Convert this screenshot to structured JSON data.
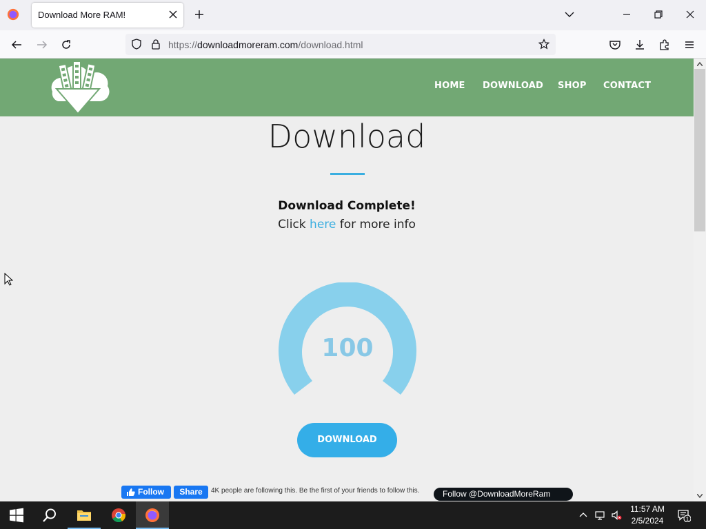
{
  "browser": {
    "tab_title": "Download More RAM!",
    "url_scheme": "https://",
    "url_host": "downloadmoreram.com",
    "url_path": "/download.html"
  },
  "site": {
    "nav": [
      "HOME",
      "DOWNLOAD",
      "SHOP",
      "CONTACT"
    ],
    "heading": "Download",
    "complete_text": "Download Complete!",
    "info_prefix": "Click",
    "info_link": "here",
    "info_suffix": "for more info",
    "gauge_value": "100",
    "download_button": "DOWNLOAD",
    "fb_follow": "Follow",
    "fb_share": "Share",
    "fb_text": "4K people are following this. Be the first of your friends to follow this.",
    "x_follow": "Follow @DownloadMoreRam"
  },
  "taskbar": {
    "time": "11:57 AM",
    "date": "2/5/2024",
    "notification_count": "1"
  },
  "colors": {
    "header_green": "#72a874",
    "accent_blue": "#34aee8",
    "gauge_blue": "#88c8e6"
  },
  "icons": [
    "firefox-icon",
    "close-icon",
    "plus-icon",
    "chevron-down-icon",
    "minimize-icon",
    "restore-icon",
    "back-icon",
    "forward-icon",
    "reload-icon",
    "shield-icon",
    "lock-icon",
    "star-icon",
    "pocket-icon",
    "download-icon",
    "extensions-icon",
    "menu-icon",
    "windows-start-icon",
    "search-icon",
    "file-explorer-icon",
    "chrome-icon",
    "chevron-up-icon",
    "network-icon",
    "volume-muted-icon",
    "notification-icon"
  ]
}
